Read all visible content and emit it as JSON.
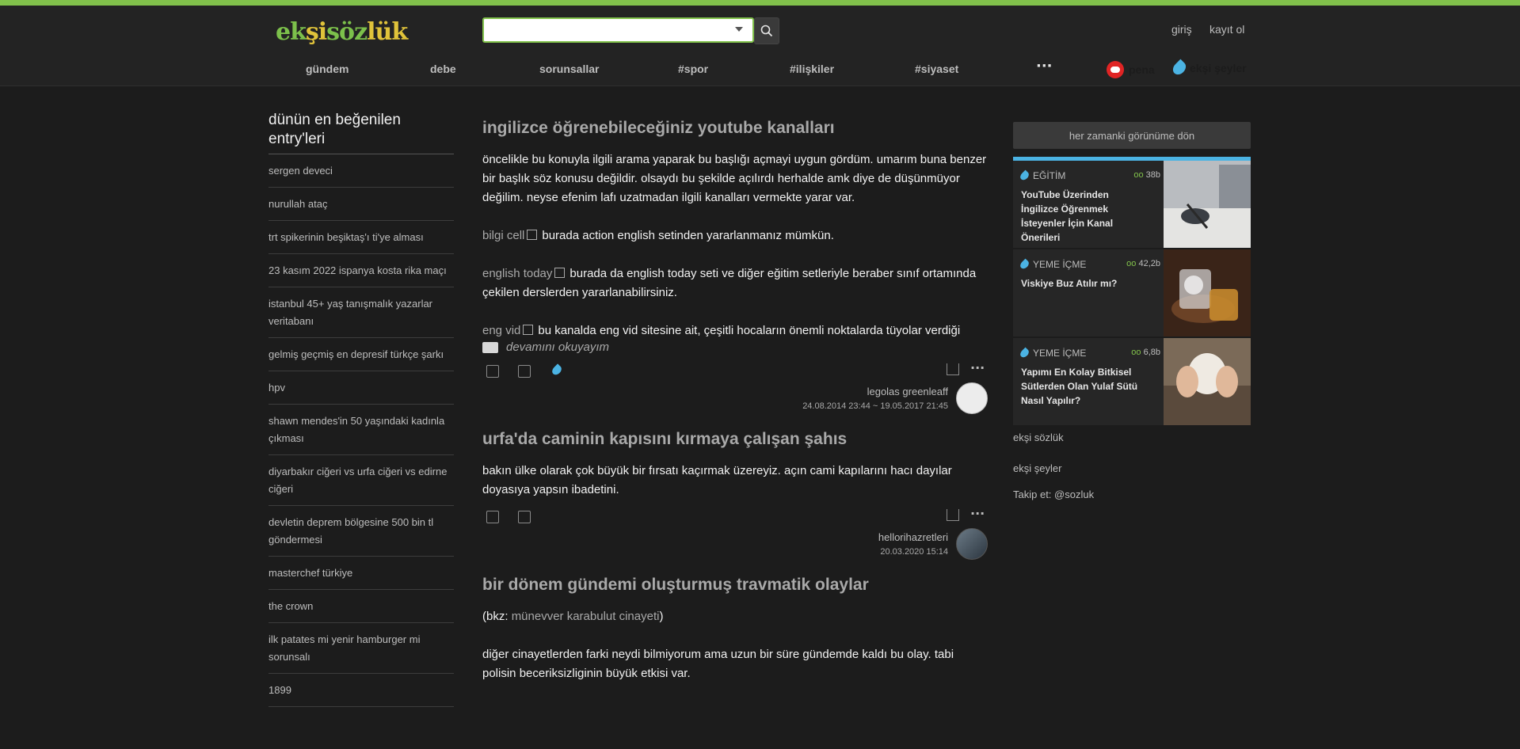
{
  "header": {
    "logo_text": "ekşisözlük",
    "login": "giriş",
    "register": "kayıt ol"
  },
  "nav": {
    "items": [
      "gündem",
      "debe",
      "sorunsallar",
      "#spor",
      "#ilişkiler",
      "#siyaset"
    ],
    "more": "···",
    "pena": "pena",
    "eksi_seyler": "ekşi şeyler"
  },
  "sidebar": {
    "title": "dünün en beğenilen entry'leri",
    "items": [
      "sergen deveci",
      "nurullah ataç",
      "trt spikerinin beşiktaş'ı ti'ye alması",
      "23 kasım 2022 ispanya kosta rika maçı",
      "istanbul 45+ yaş tanışmalık yazarlar veritabanı",
      "gelmiş geçmiş en depresif türkçe şarkı",
      "hpv",
      "shawn mendes'in 50 yaşındaki kadınla çıkması",
      "diyarbakır ciğeri vs urfa ciğeri vs edirne ciğeri",
      "devletin deprem bölgesine 500 bin tl göndermesi",
      "masterchef türkiye",
      "the crown",
      "ilk patates mi yenir hamburger mi sorunsalı",
      "1899"
    ]
  },
  "entries": [
    {
      "title": "ingilizce öğrenebileceğiniz youtube kanalları",
      "p1": "öncelikle bu konuyla ilgili arama yaparak bu başlığı açmayi uygun gördüm. umarım buna benzer bir başlık söz konusu değildir. olsaydı bu şekilde açılırdı herhalde amk diye de düşünmüyor değilim. neyse efenim lafı uzatmadan ilgili kanalları vermekte yarar var.",
      "l1": "bilgi cell",
      "t1": "burada action english setinden yararlanmanız mümkün.",
      "l2": "english today",
      "t2": "burada da english today seti ve diğer eğitim setleriyle beraber sınıf ortamında çekilen derslerden yararlanabilirsiniz.",
      "l3": "eng vid",
      "t3": "bu kanalda eng vid sitesine ait, çeşitli hocaların önemli noktalarda tüyolar verdiği",
      "read_more": "devamını okuyayım",
      "author": "legolas greenleaff",
      "date": "24.08.2014 23:44 ~ 19.05.2017 21:45"
    },
    {
      "title": "urfa'da caminin kapısını kırmaya çalışan şahıs",
      "p1": "bakın ülke olarak çok büyük bir fırsatı kaçırmak üzereyiz. açın cami kapılarını hacı dayılar doyasıya yapsın ibadetini.",
      "author": "hellorihazretleri",
      "date": "20.03.2020 15:14"
    },
    {
      "title": "bir dönem gündemi oluşturmuş travmatik olaylar",
      "bkz_prefix": "(bkz: ",
      "bkz_link": "münevver karabulut cinayeti",
      "bkz_suffix": ")",
      "p2": "diğer cinayetlerden farki neydi bilmiyorum ama uzun bir süre gündemde kaldı bu olay. tabi polisin beceriksizliginin büyük etkisi var."
    }
  ],
  "right": {
    "return_button": "her zamanki görünüme dön",
    "cards": [
      {
        "category": "EĞİTİM",
        "views": "38b",
        "title": "YouTube Üzerinden İngilizce Öğrenmek İsteyenler İçin Kanal Önerileri"
      },
      {
        "category": "YEME İÇME",
        "views": "42,2b",
        "title": "Viskiye Buz Atılır mı?"
      },
      {
        "category": "YEME İÇME",
        "views": "6,8b",
        "title": "Yapımı En Kolay Bitkisel Sütlerden Olan Yulaf Sütü Nasıl Yapılır?"
      }
    ],
    "footer_links": [
      "ekşi sözlük",
      "ekşi şeyler",
      "Takip et: @sozluk"
    ]
  },
  "colors": {
    "accent": "#81c14b",
    "drop": "#4bb3e3",
    "background": "#1c1c1c"
  }
}
